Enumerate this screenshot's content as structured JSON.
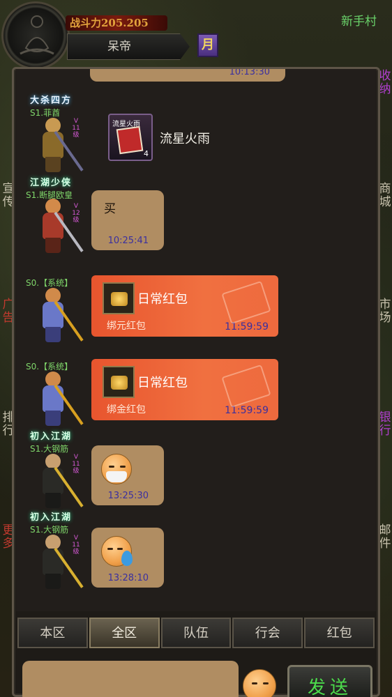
{
  "header": {
    "combat_power": "战斗力205.205",
    "player_name": "呆帝",
    "month_badge": "月",
    "location": "新手村"
  },
  "side_left": [
    {
      "text": "宣\n传",
      "color": "normal"
    },
    {
      "text": "广\n告",
      "color": "red"
    },
    {
      "text": "排\n行",
      "color": "normal"
    },
    {
      "text": "更\n多",
      "color": "red"
    }
  ],
  "side_right": [
    {
      "text": "收\n纳",
      "color": "purple"
    },
    {
      "text": "商\n城",
      "color": "normal"
    },
    {
      "text": "市\n场",
      "color": "normal"
    },
    {
      "text": "银\n行",
      "color": "purple"
    },
    {
      "text": "邮\n件",
      "color": "normal"
    }
  ],
  "messages": [
    {
      "time": "10:13:30"
    },
    {
      "title": "大杀四方",
      "sender": "S1.菲酋",
      "level": "V\n11\n级",
      "item_label": "流星火雨",
      "item_count": "4",
      "item_name": "流星火雨"
    },
    {
      "title": "江湖少侠",
      "sender": "S1.断腿欧皇",
      "level": "V\n12\n级",
      "text": "买",
      "time": "10:25:41"
    },
    {
      "sender": "S0.【系统】",
      "rp_title": "日常红包",
      "rp_type": "绑元红包",
      "time": "11:59:59"
    },
    {
      "sender": "S0.【系统】",
      "rp_title": "日常红包",
      "rp_type": "绑金红包",
      "time": "11:59:59"
    },
    {
      "title": "初入江湖",
      "sender": "S1.大钢筋",
      "level": "V\n11\n级",
      "time": "13:25:30"
    },
    {
      "title": "初入江湖",
      "sender": "S1.大钢筋",
      "level": "V\n11\n级",
      "time": "13:28:10"
    }
  ],
  "tabs": [
    "本区",
    "全区",
    "队伍",
    "行会",
    "红包"
  ],
  "active_tab": "全区",
  "input": {
    "value": "",
    "placeholder": ""
  },
  "send_label": "发送",
  "colors": {
    "accent_green": "#4cdc4c",
    "bubble": "#b08d62",
    "red_packet": "#ee6a3e",
    "time_text": "#3a2fa0"
  }
}
